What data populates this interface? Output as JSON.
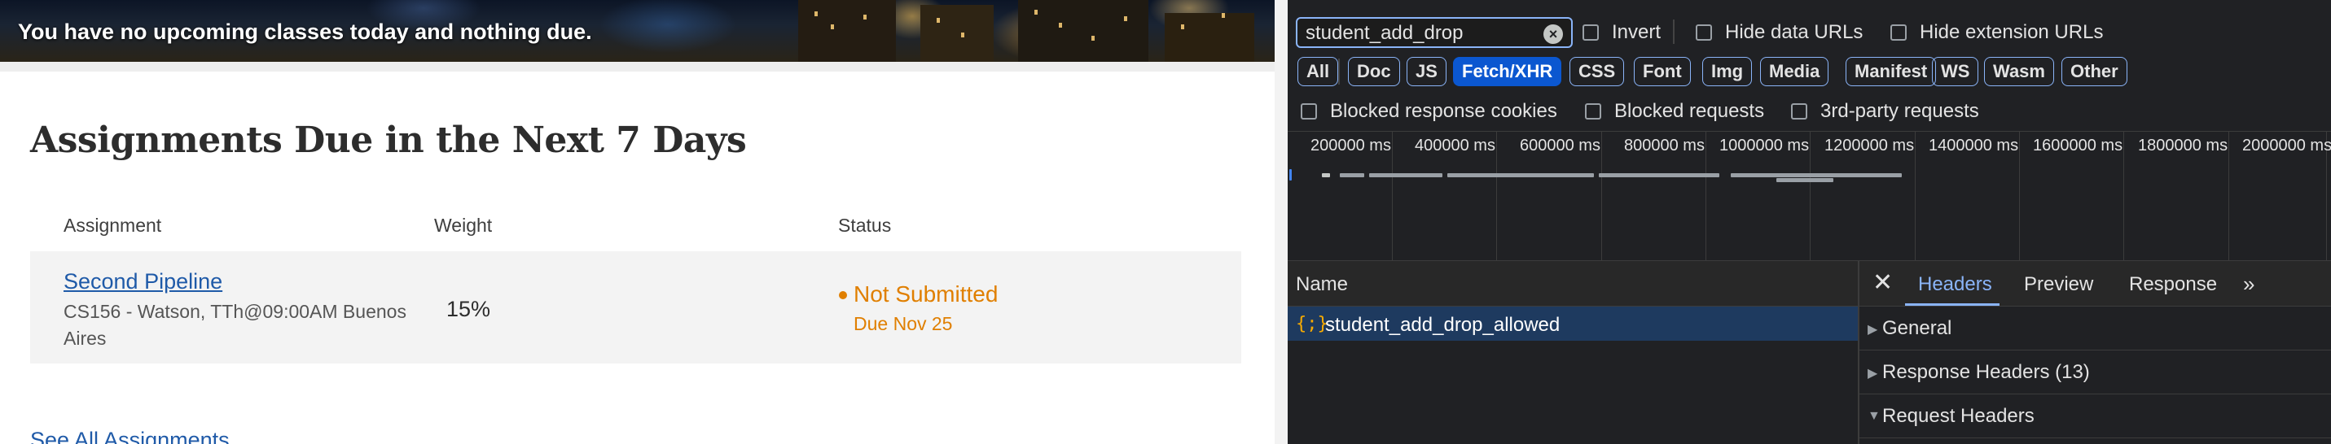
{
  "hero": {
    "message": "You have no upcoming classes today and nothing due."
  },
  "assignments": {
    "heading": "Assignments Due in the Next 7 Days",
    "columns": [
      "Assignment",
      "Weight",
      "Status"
    ],
    "rows": [
      {
        "title": "Second Pipeline",
        "subtitle": "CS156 - Watson, TTh@09:00AM Buenos Aires",
        "weight": "15%",
        "status": "Not Submitted",
        "due": "Due Nov 25"
      }
    ],
    "see_all": "See All Assignments"
  },
  "devtools": {
    "filter": {
      "value": "student_add_drop"
    },
    "toolbar_checkboxes": [
      "Invert",
      "Hide data URLs",
      "Hide extension URLs"
    ],
    "type_filters": [
      "All",
      "Doc",
      "JS",
      "Fetch/XHR",
      "CSS",
      "Font",
      "Img",
      "Media",
      "Manifest",
      "WS",
      "Wasm",
      "Other"
    ],
    "active_type_filter": "Fetch/XHR",
    "second_row_checkboxes": [
      "Blocked response cookies",
      "Blocked requests",
      "3rd-party requests"
    ],
    "timeline_ticks": [
      "200000 ms",
      "400000 ms",
      "600000 ms",
      "800000 ms",
      "1000000 ms",
      "1200000 ms",
      "1400000 ms",
      "1600000 ms",
      "1800000 ms",
      "2000000 ms"
    ],
    "name_column_header": "Name",
    "requests": [
      {
        "icon": "{;}",
        "name": "student_add_drop_allowed"
      }
    ],
    "detail_tabs": [
      "Headers",
      "Preview",
      "Response"
    ],
    "active_detail_tab": "Headers",
    "sections": [
      {
        "label": "General",
        "expanded": false
      },
      {
        "label": "Response Headers (13)",
        "expanded": false
      },
      {
        "label": "Request Headers",
        "expanded": true
      }
    ],
    "colors": {
      "accent": "#8ab4f8",
      "active_chip": "#0b57d0",
      "selected_row": "#1e3a5f",
      "xhr_icon": "#f9ab00"
    }
  },
  "colors": {
    "link": "#1f5aa8",
    "status_warning": "#e07f00"
  }
}
